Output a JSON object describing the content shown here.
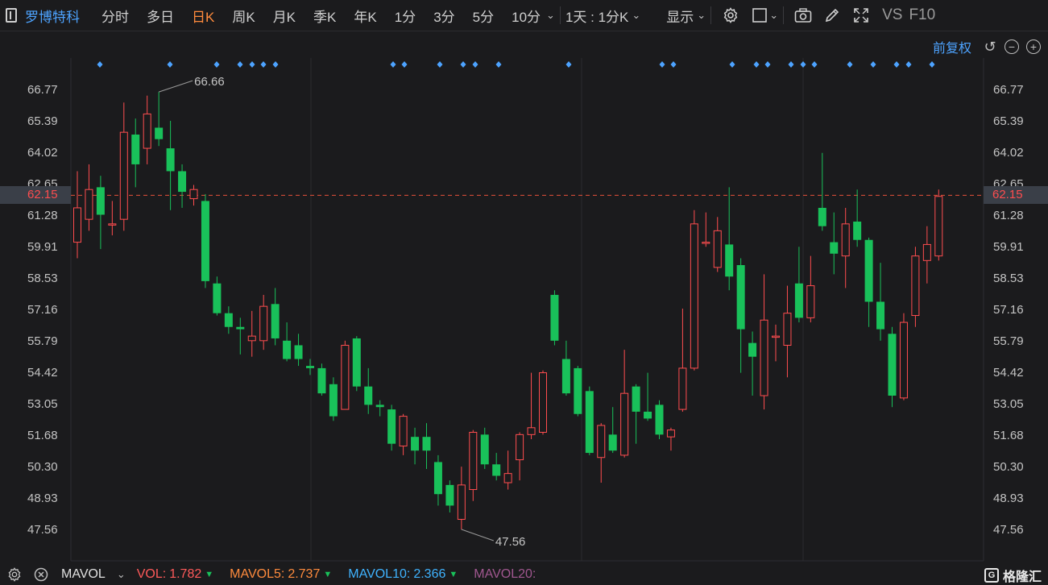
{
  "toolbar": {
    "stock_name": "罗博特科",
    "items": [
      {
        "label": "分时",
        "active": false
      },
      {
        "label": "多日",
        "active": false
      },
      {
        "label": "日K",
        "active": true
      },
      {
        "label": "周K",
        "active": false
      },
      {
        "label": "月K",
        "active": false
      },
      {
        "label": "季K",
        "active": false
      },
      {
        "label": "年K",
        "active": false
      },
      {
        "label": "1分",
        "active": false
      },
      {
        "label": "3分",
        "active": false
      },
      {
        "label": "5分",
        "active": false
      },
      {
        "label": "10分",
        "active": false
      }
    ],
    "period_select": "1天 : 1分K",
    "display_label": "显示",
    "vs_label": "VS",
    "f10_label": "F10",
    "icons": [
      "sidebar-toggle-icon",
      "gear-icon",
      "square-icon",
      "camera-icon",
      "pencil-icon",
      "fullscreen-icon"
    ]
  },
  "subheader": {
    "adjust_label": "前复权",
    "icons": [
      "reset-icon",
      "zoom-out-icon",
      "zoom-in-icon"
    ]
  },
  "price_tags": {
    "current": "62.15"
  },
  "colors": {
    "up": "#ff4d4f",
    "down": "#19c15a",
    "accent": "#4da3ff",
    "active_tab": "#ff8b3d",
    "price_line": "#e5523a"
  },
  "chart_data": {
    "type": "candlestick",
    "y_ticks": [
      "66.77",
      "65.39",
      "64.02",
      "62.65",
      "61.28",
      "59.91",
      "58.53",
      "57.16",
      "55.79",
      "54.42",
      "53.05",
      "51.68",
      "50.30",
      "48.93",
      "47.56"
    ],
    "ylim": [
      47.56,
      66.77
    ],
    "current_price": 62.15,
    "annotations": [
      {
        "label": "66.66",
        "value": 66.66,
        "type": "high"
      },
      {
        "label": "47.56",
        "value": 47.56,
        "type": "low"
      }
    ],
    "candles": [
      {
        "o": 60.1,
        "c": 61.6,
        "h": 63.2,
        "l": 59.4
      },
      {
        "o": 61.1,
        "c": 62.4,
        "h": 63.5,
        "l": 60.6
      },
      {
        "o": 62.5,
        "c": 61.3,
        "h": 63.0,
        "l": 59.8
      },
      {
        "o": 60.9,
        "c": 60.9,
        "h": 61.9,
        "l": 60.4
      },
      {
        "o": 61.1,
        "c": 64.9,
        "h": 66.2,
        "l": 60.6
      },
      {
        "o": 64.8,
        "c": 63.5,
        "h": 65.5,
        "l": 62.5
      },
      {
        "o": 64.2,
        "c": 65.7,
        "h": 66.5,
        "l": 63.5
      },
      {
        "o": 65.1,
        "c": 64.6,
        "h": 66.66,
        "l": 64.3
      },
      {
        "o": 64.2,
        "c": 63.2,
        "h": 65.4,
        "l": 61.5
      },
      {
        "o": 63.2,
        "c": 62.3,
        "h": 63.5,
        "l": 61.6
      },
      {
        "o": 62.0,
        "c": 62.4,
        "h": 62.6,
        "l": 61.7
      },
      {
        "o": 61.9,
        "c": 58.4,
        "h": 62.2,
        "l": 58.1
      },
      {
        "o": 58.3,
        "c": 57.0,
        "h": 58.6,
        "l": 56.9
      },
      {
        "o": 57.0,
        "c": 56.4,
        "h": 57.3,
        "l": 56.1
      },
      {
        "o": 56.4,
        "c": 56.3,
        "h": 56.8,
        "l": 55.2
      },
      {
        "o": 55.8,
        "c": 56.0,
        "h": 57.1,
        "l": 55.1
      },
      {
        "o": 55.8,
        "c": 57.3,
        "h": 57.8,
        "l": 55.4
      },
      {
        "o": 57.4,
        "c": 55.9,
        "h": 58.1,
        "l": 55.6
      },
      {
        "o": 55.8,
        "c": 55.0,
        "h": 56.6,
        "l": 54.9
      },
      {
        "o": 55.6,
        "c": 55.0,
        "h": 56.1,
        "l": 54.7
      },
      {
        "o": 54.7,
        "c": 54.6,
        "h": 55.0,
        "l": 54.3
      },
      {
        "o": 54.6,
        "c": 53.5,
        "h": 54.8,
        "l": 53.4
      },
      {
        "o": 53.9,
        "c": 52.5,
        "h": 54.2,
        "l": 52.3
      },
      {
        "o": 52.8,
        "c": 55.6,
        "h": 55.8,
        "l": 52.8
      },
      {
        "o": 55.9,
        "c": 53.8,
        "h": 56.0,
        "l": 53.6
      },
      {
        "o": 53.8,
        "c": 53.0,
        "h": 54.6,
        "l": 52.6
      },
      {
        "o": 53.0,
        "c": 52.9,
        "h": 53.2,
        "l": 52.5
      },
      {
        "o": 52.8,
        "c": 51.3,
        "h": 53.0,
        "l": 51.0
      },
      {
        "o": 51.2,
        "c": 52.5,
        "h": 52.6,
        "l": 50.8
      },
      {
        "o": 51.6,
        "c": 51.0,
        "h": 52.0,
        "l": 50.4
      },
      {
        "o": 51.6,
        "c": 51.0,
        "h": 52.2,
        "l": 50.2
      },
      {
        "o": 50.5,
        "c": 49.1,
        "h": 50.8,
        "l": 48.6
      },
      {
        "o": 49.5,
        "c": 48.6,
        "h": 49.7,
        "l": 48.3
      },
      {
        "o": 48.0,
        "c": 49.5,
        "h": 50.3,
        "l": 47.56
      },
      {
        "o": 49.3,
        "c": 51.8,
        "h": 51.9,
        "l": 48.8
      },
      {
        "o": 51.7,
        "c": 50.4,
        "h": 52.0,
        "l": 50.2
      },
      {
        "o": 50.4,
        "c": 49.9,
        "h": 50.9,
        "l": 49.7
      },
      {
        "o": 49.6,
        "c": 50.0,
        "h": 51.0,
        "l": 49.3
      },
      {
        "o": 50.6,
        "c": 51.7,
        "h": 51.8,
        "l": 49.7
      },
      {
        "o": 51.7,
        "c": 52.0,
        "h": 54.4,
        "l": 51.5
      },
      {
        "o": 51.8,
        "c": 54.4,
        "h": 54.5,
        "l": 51.7
      },
      {
        "o": 57.8,
        "c": 55.8,
        "h": 58.0,
        "l": 55.6
      },
      {
        "o": 55.0,
        "c": 53.5,
        "h": 55.8,
        "l": 53.4
      },
      {
        "o": 54.6,
        "c": 52.6,
        "h": 54.7,
        "l": 52.5
      },
      {
        "o": 53.6,
        "c": 50.9,
        "h": 53.8,
        "l": 50.8
      },
      {
        "o": 50.7,
        "c": 52.1,
        "h": 52.2,
        "l": 49.6
      },
      {
        "o": 51.7,
        "c": 51.0,
        "h": 52.9,
        "l": 50.9
      },
      {
        "o": 50.8,
        "c": 53.5,
        "h": 55.4,
        "l": 50.7
      },
      {
        "o": 53.8,
        "c": 52.7,
        "h": 53.9,
        "l": 51.3
      },
      {
        "o": 52.7,
        "c": 52.4,
        "h": 54.4,
        "l": 52.3
      },
      {
        "o": 53.0,
        "c": 51.7,
        "h": 53.2,
        "l": 51.5
      },
      {
        "o": 51.6,
        "c": 51.9,
        "h": 52.0,
        "l": 51.0
      },
      {
        "o": 52.8,
        "c": 54.6,
        "h": 57.2,
        "l": 52.7
      },
      {
        "o": 54.6,
        "c": 60.9,
        "h": 61.5,
        "l": 54.5
      },
      {
        "o": 60.1,
        "c": 60.1,
        "h": 61.4,
        "l": 59.9
      },
      {
        "o": 59.0,
        "c": 60.6,
        "h": 61.2,
        "l": 58.8
      },
      {
        "o": 60.0,
        "c": 58.6,
        "h": 62.5,
        "l": 58.0
      },
      {
        "o": 59.1,
        "c": 56.3,
        "h": 59.4,
        "l": 54.4
      },
      {
        "o": 55.7,
        "c": 55.1,
        "h": 56.2,
        "l": 53.4
      },
      {
        "o": 53.4,
        "c": 56.7,
        "h": 58.7,
        "l": 52.8
      },
      {
        "o": 56.0,
        "c": 56.0,
        "h": 56.5,
        "l": 54.9
      },
      {
        "o": 55.6,
        "c": 57.0,
        "h": 58.2,
        "l": 54.2
      },
      {
        "o": 58.3,
        "c": 56.8,
        "h": 59.9,
        "l": 56.6
      },
      {
        "o": 56.8,
        "c": 58.2,
        "h": 59.5,
        "l": 56.6
      },
      {
        "o": 61.6,
        "c": 60.8,
        "h": 64.0,
        "l": 60.6
      },
      {
        "o": 60.1,
        "c": 59.6,
        "h": 61.4,
        "l": 58.7
      },
      {
        "o": 59.5,
        "c": 60.9,
        "h": 61.6,
        "l": 58.1
      },
      {
        "o": 61.0,
        "c": 60.2,
        "h": 62.4,
        "l": 59.9
      },
      {
        "o": 60.2,
        "c": 57.5,
        "h": 60.3,
        "l": 56.4
      },
      {
        "o": 57.5,
        "c": 56.3,
        "h": 59.2,
        "l": 55.8
      },
      {
        "o": 56.1,
        "c": 53.4,
        "h": 56.4,
        "l": 52.9
      },
      {
        "o": 53.3,
        "c": 56.6,
        "h": 57.0,
        "l": 53.2
      },
      {
        "o": 56.9,
        "c": 59.5,
        "h": 59.9,
        "l": 56.4
      },
      {
        "o": 59.3,
        "c": 60.0,
        "h": 60.8,
        "l": 58.3
      },
      {
        "o": 59.5,
        "c": 62.1,
        "h": 62.4,
        "l": 59.3
      }
    ]
  },
  "markers": {
    "count": 29
  },
  "bottom": {
    "mode_label": "MAVOL",
    "vol_label": "VOL:",
    "vol_value": "1.782",
    "ma5_label": "MAVOL5:",
    "ma5_value": "2.737",
    "ma10_label": "MAVOL10:",
    "ma10_value": "2.366",
    "ma20_label": "MAVOL20:",
    "down_arrow": "▼",
    "watermark": "格隆汇",
    "watermark_logo": "G"
  }
}
